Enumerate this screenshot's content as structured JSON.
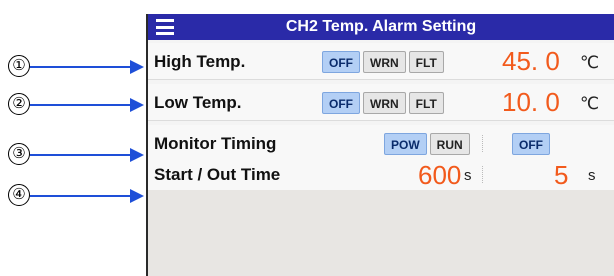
{
  "callouts": [
    "①",
    "②",
    "③",
    "④"
  ],
  "title": "CH2 Temp. Alarm Setting",
  "rows": {
    "high": {
      "label": "High Temp.",
      "modes": [
        "OFF",
        "WRN",
        "FLT"
      ],
      "active": "OFF",
      "value": "45. 0",
      "unit": "℃"
    },
    "low": {
      "label": "Low Temp.",
      "modes": [
        "OFF",
        "WRN",
        "FLT"
      ],
      "active": "OFF",
      "value": "10. 0",
      "unit": "℃"
    },
    "monitor": {
      "label": "Monitor Timing",
      "modes": [
        "POW",
        "RUN"
      ],
      "active": "POW",
      "option": "OFF"
    },
    "start_out": {
      "label": "Start / Out Time",
      "start_value": "600",
      "start_unit": "s",
      "out_value": "5",
      "out_unit": "s"
    }
  },
  "colors": {
    "title_bar": "#2a2aa8",
    "value": "#f25a1c",
    "active_pill": "#b3cff5",
    "callout_arrow": "#1e4fd8"
  },
  "icons": {
    "menu": "hamburger-menu-icon"
  }
}
